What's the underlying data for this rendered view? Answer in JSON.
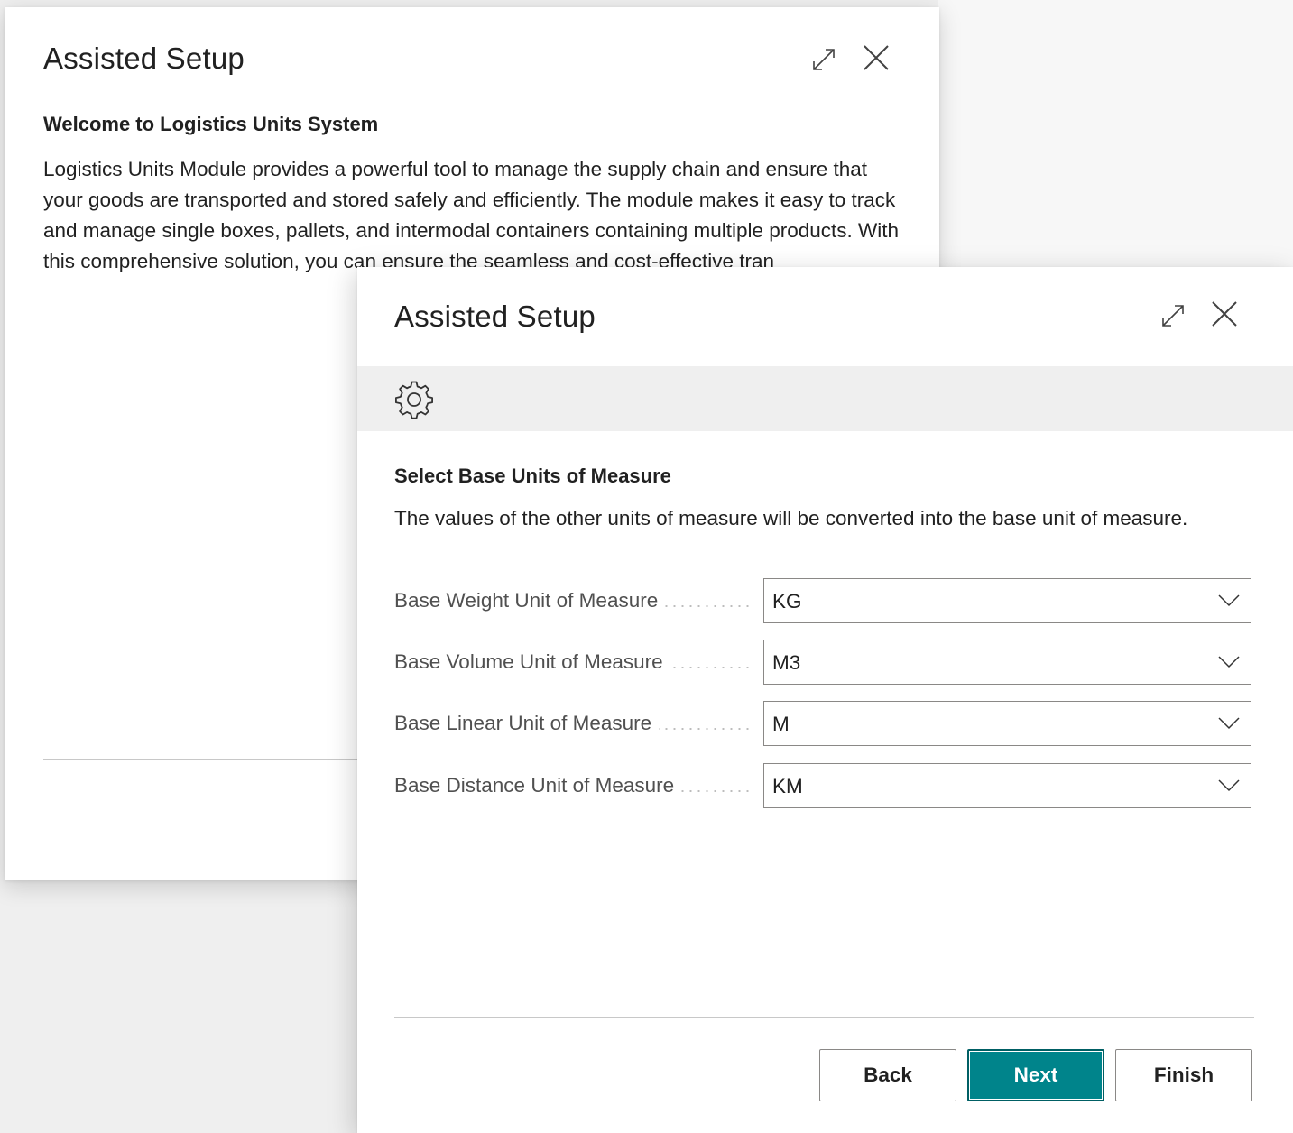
{
  "back_dialog": {
    "title": "Assisted Setup",
    "heading": "Welcome to Logistics Units System",
    "body": "Logistics Units Module provides a powerful tool to manage the supply chain and ensure that your goods are transported and stored safely and efficiently. The module makes it easy to track and manage single boxes, pallets, and intermodal containers containing multiple products. With this comprehensive solution, you can ensure the seamless and cost-effective tran"
  },
  "front_dialog": {
    "title": "Assisted Setup",
    "heading": "Select Base Units of Measure",
    "description": "The values of the other units of measure will be converted into the base unit of measure.",
    "fields": [
      {
        "label": "Base Weight Unit of Measure",
        "value": "KG"
      },
      {
        "label": "Base Volume Unit of Measure",
        "value": "M3"
      },
      {
        "label": "Base Linear Unit of Measure",
        "value": "M"
      },
      {
        "label": "Base Distance Unit of Measure",
        "value": "KM"
      }
    ],
    "buttons": {
      "back": "Back",
      "next": "Next",
      "finish": "Finish"
    }
  },
  "icons": {
    "expand": "expand-icon",
    "close": "close-icon",
    "settings": "gear-icon",
    "dropdown": "chevron-down-icon"
  },
  "colors": {
    "primary_button": "#00848b",
    "page_background": "#efefef",
    "band_background": "#efefef"
  }
}
